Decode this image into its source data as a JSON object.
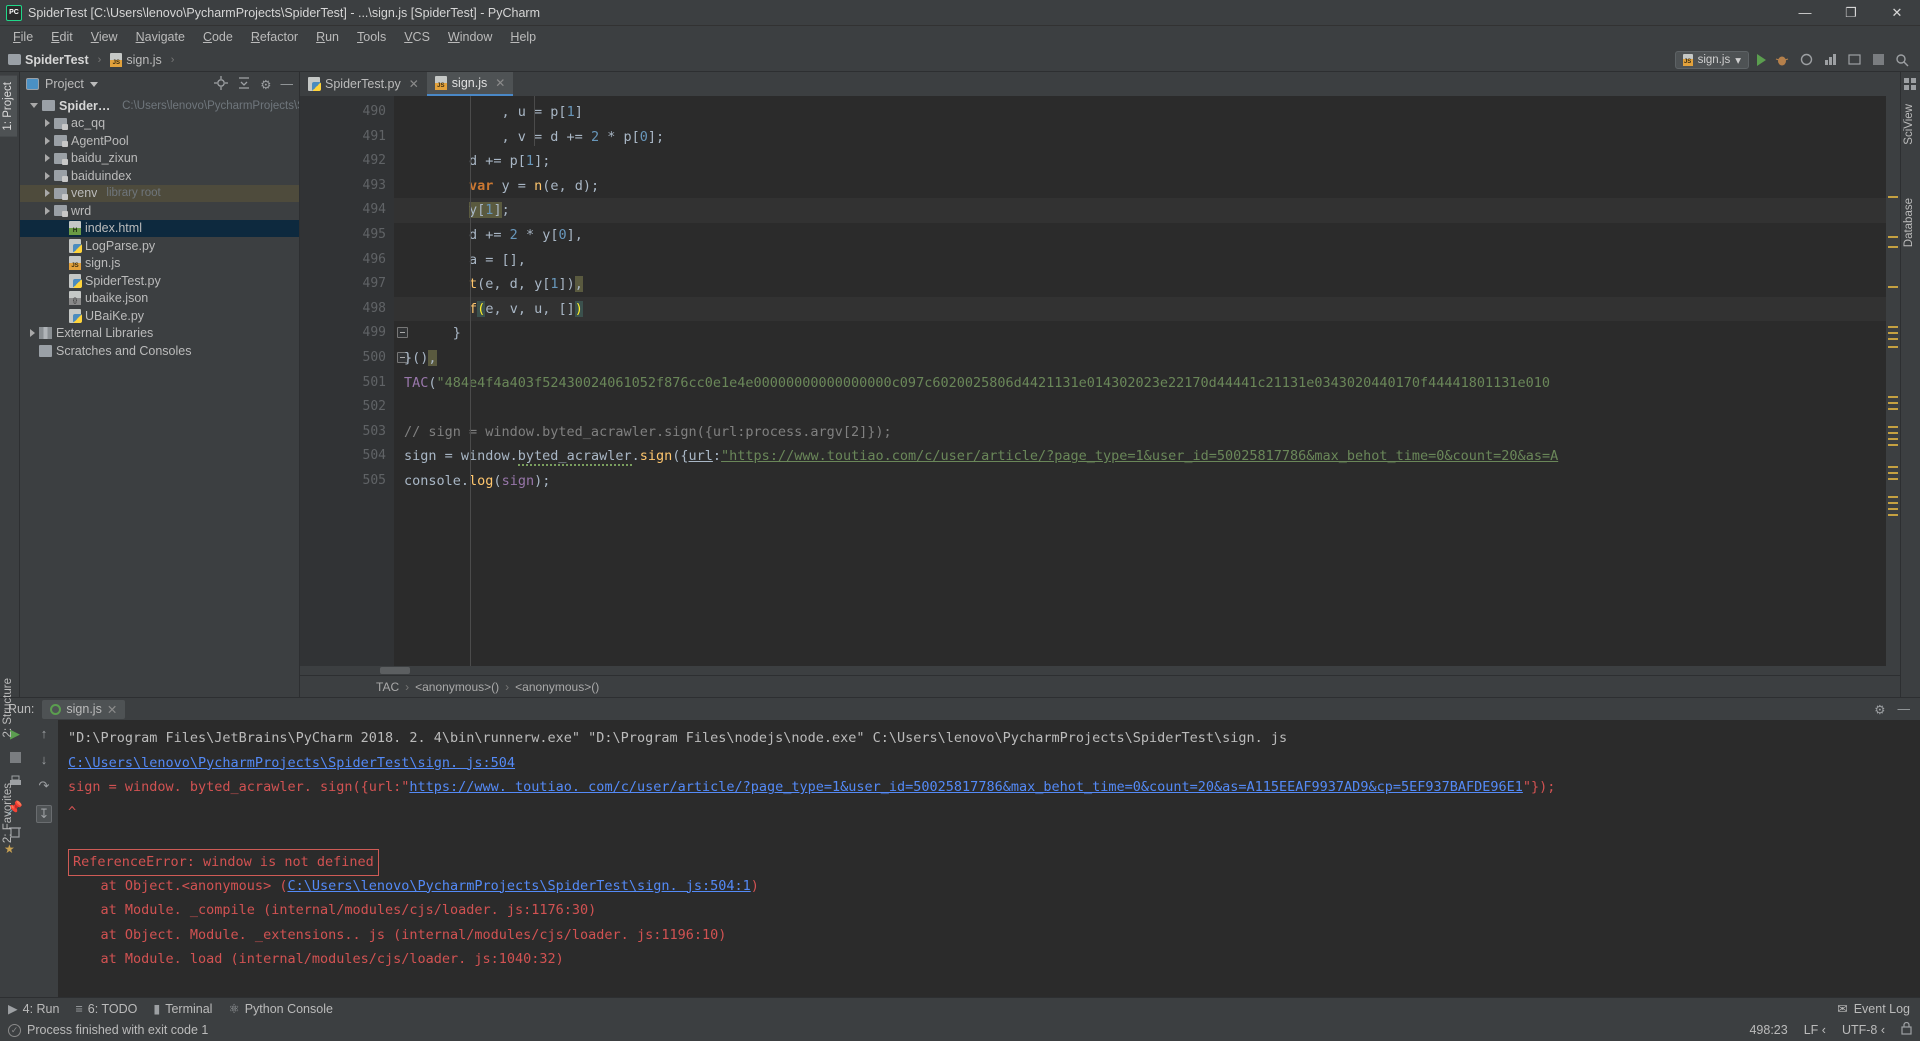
{
  "titlebar": {
    "title": "SpiderTest [C:\\Users\\lenovo\\PycharmProjects\\SpiderTest] - ...\\sign.js [SpiderTest] - PyCharm",
    "logo": "PC",
    "minimize": "—",
    "maximize": "❐",
    "close": "✕"
  },
  "menu": [
    "File",
    "Edit",
    "View",
    "Navigate",
    "Code",
    "Refactor",
    "Run",
    "Tools",
    "VCS",
    "Window",
    "Help"
  ],
  "breadcrumb": {
    "project": "SpiderTest",
    "file": "sign.js",
    "separator": "›"
  },
  "navbar_right": {
    "run_config": "sign.js",
    "caret": "▾"
  },
  "left_strip": {
    "project_tab": "1: Project"
  },
  "left_strip_bottom": {
    "structure_tab": "2: Structure",
    "favorites_tab": "2: Favorites"
  },
  "right_strip": {
    "sciview_tab": "SciView",
    "database_tab": "Database"
  },
  "project_panel": {
    "header": "Project",
    "tree": [
      {
        "label": "SpiderTest",
        "path": "C:\\Users\\lenovo\\PycharmProjects\\Spider",
        "type": "root",
        "depth": 0,
        "expanded": true,
        "bold": true
      },
      {
        "label": "ac_qq",
        "type": "folder",
        "depth": 1,
        "expanded": false
      },
      {
        "label": "AgentPool",
        "type": "folder",
        "depth": 1,
        "expanded": false
      },
      {
        "label": "baidu_zixun",
        "type": "folder",
        "depth": 1,
        "expanded": false
      },
      {
        "label": "baiduindex",
        "type": "folder",
        "depth": 1,
        "expanded": false
      },
      {
        "label": "venv",
        "suffix": "library root",
        "type": "folder",
        "depth": 1,
        "expanded": false,
        "highlight": true
      },
      {
        "label": "wrd",
        "type": "folder",
        "depth": 1,
        "expanded": false
      },
      {
        "label": "index.html",
        "type": "html",
        "depth": 2,
        "selected": true
      },
      {
        "label": "LogParse.py",
        "type": "py",
        "depth": 2
      },
      {
        "label": "sign.js",
        "type": "js",
        "depth": 2
      },
      {
        "label": "SpiderTest.py",
        "type": "py",
        "depth": 2
      },
      {
        "label": "ubaike.json",
        "type": "json",
        "depth": 2
      },
      {
        "label": "UBaiKe.py",
        "type": "py",
        "depth": 2
      },
      {
        "label": "External Libraries",
        "type": "lib",
        "depth": 0,
        "expanded": false
      },
      {
        "label": "Scratches and Consoles",
        "type": "scratch",
        "depth": 0
      }
    ]
  },
  "editor": {
    "tabs": [
      {
        "label": "SpiderTest.py",
        "type": "py",
        "active": false,
        "close": "✕"
      },
      {
        "label": "sign.js",
        "type": "js",
        "active": true,
        "close": "✕"
      }
    ],
    "first_line_number": 490,
    "lines": [
      {
        "n": 490,
        "text": "            , u = p[1]"
      },
      {
        "n": 491,
        "text": "            , v = d += 2 * p[0];"
      },
      {
        "n": 492,
        "text": "        d += p[1];"
      },
      {
        "n": 493,
        "text": "        var y = n(e, d);"
      },
      {
        "n": 494,
        "text": "        y[1];",
        "current": true
      },
      {
        "n": 495,
        "text": "        d += 2 * y[0],"
      },
      {
        "n": 496,
        "text": "        a = [],"
      },
      {
        "n": 497,
        "text": "        t(e, d, y[1]),"
      },
      {
        "n": 498,
        "text": "        f(e, v, u, [])",
        "current": true
      },
      {
        "n": 499,
        "text": "      }",
        "fold": true
      },
      {
        "n": 500,
        "text": "}(),",
        "fold": true
      },
      {
        "n": 501,
        "text": "TAC(\"484e4f4a403f52430024061052f876cc0e1e4e00000000000000000c097c6020025806d4421131e014302023e22170d44441c21131e0343020440170f44441801131e010"
      },
      {
        "n": 502,
        "text": ""
      },
      {
        "n": 503,
        "text": "// sign = window.byted_acrawler.sign({url:process.argv[2]});"
      },
      {
        "n": 504,
        "text": "sign = window.byted_acrawler.sign({url:\"https://www.toutiao.com/c/user/article/?page_type=1&user_id=50025817786&max_behot_time=0&count=20&as=A"
      },
      {
        "n": 505,
        "text": "console.log(sign);"
      }
    ],
    "breadcrumb": [
      "TAC",
      "<anonymous>()",
      "<anonymous>()"
    ],
    "breadcrumb_sep": "›"
  },
  "run_panel": {
    "label": "Run:",
    "tab_label": "sign.js",
    "tab_close": "✕",
    "console_lines": [
      {
        "kind": "plain",
        "text": "\"D:\\Program Files\\JetBrains\\PyCharm 2018. 2. 4\\bin\\runnerw.exe\" \"D:\\Program Files\\nodejs\\node.exe\" C:\\Users\\lenovo\\PycharmProjects\\SpiderTest\\sign. js"
      },
      {
        "kind": "link",
        "text": "C:\\Users\\lenovo\\PycharmProjects\\SpiderTest\\sign. js:504"
      },
      {
        "kind": "err-with-link",
        "pre": "sign = window. byted_acrawler. sign({url:\"",
        "link": "https://www. toutiao. com/c/user/article/?page_type=1&user_id=50025817786&max_behot_time=0&count=20&as=A115EEAF9937AD9&cp=5EF937BAFDE96E1",
        "post": "\"});"
      },
      {
        "kind": "err",
        "text": "^"
      },
      {
        "kind": "blank",
        "text": ""
      },
      {
        "kind": "errbox",
        "text": "ReferenceError: window is not defined"
      },
      {
        "kind": "err-trace",
        "pre": "    at Object.<anonymous> (",
        "link": "C:\\Users\\lenovo\\PycharmProjects\\SpiderTest\\sign. js:504:1",
        "post": ")"
      },
      {
        "kind": "err",
        "text": "    at Module. _compile (internal/modules/cjs/loader. js:1176:30)"
      },
      {
        "kind": "err",
        "text": "    at Object. Module. _extensions.. js (internal/modules/cjs/loader. js:1196:10)"
      },
      {
        "kind": "err",
        "text": "    at Module. load (internal/modules/cjs/loader. js:1040:32)"
      }
    ]
  },
  "bottom_tabs": [
    {
      "label": "4: Run",
      "icon": "run-icon"
    },
    {
      "label": "6: TODO",
      "icon": "todo-icon"
    },
    {
      "label": "Terminal",
      "icon": "terminal-icon"
    },
    {
      "label": "Python Console",
      "icon": "python-icon"
    }
  ],
  "bottom_right": {
    "event_log": "Event Log"
  },
  "statusbar": {
    "message": "Process finished with exit code 1",
    "caret": "498:23",
    "line_sep": "LF ‹",
    "encoding": "UTF-8 ‹",
    "lock": "🔒"
  }
}
